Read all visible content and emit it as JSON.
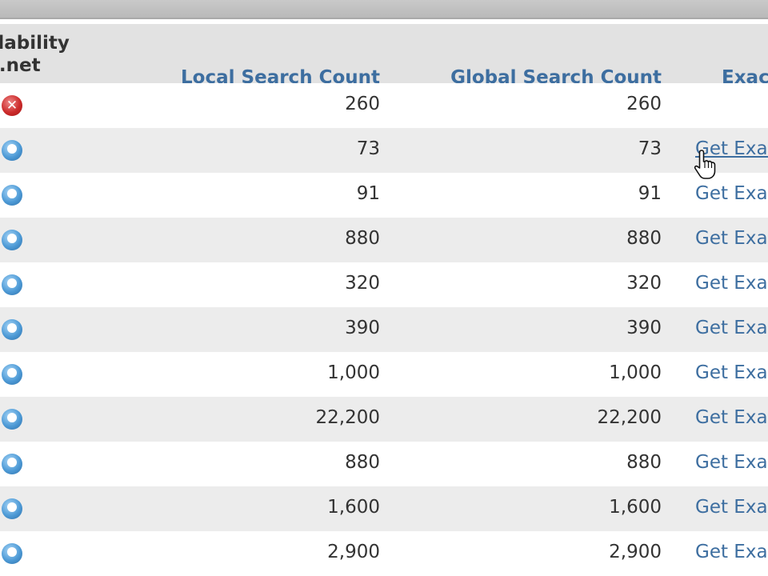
{
  "header": {
    "availability_line1": "ailability",
    "availability_line2": "g/.net",
    "local_count": "Local Search Count",
    "global_count": "Global Search Count",
    "exact": "Exac"
  },
  "rows": [
    {
      "status": "unavailable",
      "local": "260",
      "global": "260",
      "exact": ""
    },
    {
      "status": "info",
      "local": "73",
      "global": "73",
      "exact": "Get Exac"
    },
    {
      "status": "info",
      "local": "91",
      "global": "91",
      "exact": "Get Exac"
    },
    {
      "status": "info",
      "local": "880",
      "global": "880",
      "exact": "Get Exac"
    },
    {
      "status": "info",
      "local": "320",
      "global": "320",
      "exact": "Get Exac"
    },
    {
      "status": "info",
      "local": "390",
      "global": "390",
      "exact": "Get Exac"
    },
    {
      "status": "info",
      "local": "1,000",
      "global": "1,000",
      "exact": "Get Exac"
    },
    {
      "status": "info",
      "local": "22,200",
      "global": "22,200",
      "exact": "Get Exac"
    },
    {
      "status": "info",
      "local": "880",
      "global": "880",
      "exact": "Get Exac"
    },
    {
      "status": "info",
      "local": "1,600",
      "global": "1,600",
      "exact": "Get Exac"
    },
    {
      "status": "info",
      "local": "2,900",
      "global": "2,900",
      "exact": "Get Exac"
    }
  ],
  "icons": {
    "unavailable": "x-circle-icon",
    "info": "info-circle-icon",
    "cursor": "hand-pointer-icon"
  },
  "colors": {
    "link": "#3d6ea0",
    "header_bg": "#e2e2e2",
    "row_alt": "#ececec",
    "unavailable": "#cc2b2b",
    "info": "#4d9ad6"
  }
}
